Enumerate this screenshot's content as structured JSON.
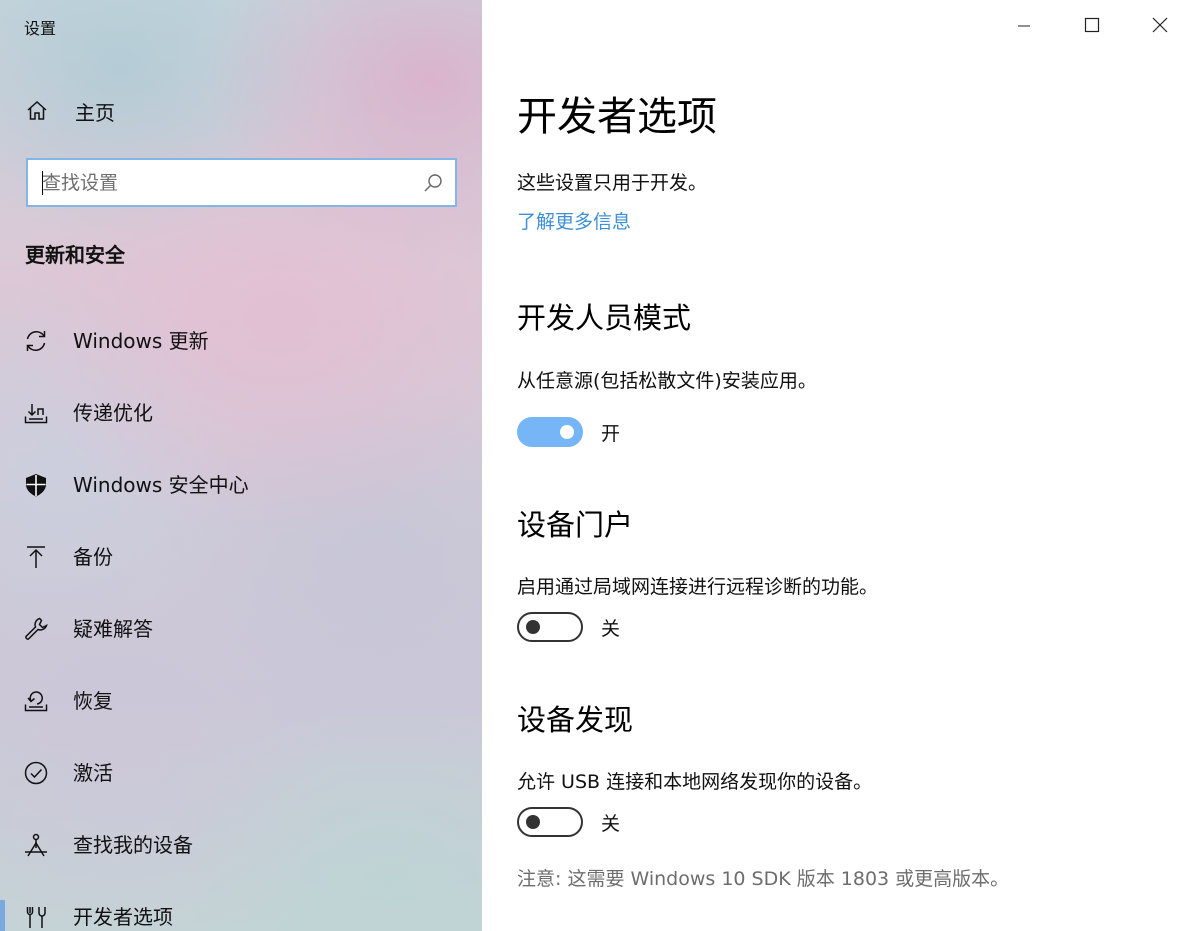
{
  "window": {
    "title": "设置"
  },
  "sidebar": {
    "home_label": "主页",
    "search_placeholder": "查找设置",
    "section_title": "更新和安全",
    "items": [
      {
        "label": "Windows 更新",
        "icon": "refresh-icon"
      },
      {
        "label": "传递优化",
        "icon": "delivery-optimization-icon"
      },
      {
        "label": "Windows 安全中心",
        "icon": "shield-icon"
      },
      {
        "label": "备份",
        "icon": "backup-arrow-icon"
      },
      {
        "label": "疑难解答",
        "icon": "wrench-icon"
      },
      {
        "label": "恢复",
        "icon": "recovery-icon"
      },
      {
        "label": "激活",
        "icon": "checkmark-circle-icon"
      },
      {
        "label": "查找我的设备",
        "icon": "find-device-icon"
      },
      {
        "label": "开发者选项",
        "icon": "developer-tools-icon",
        "selected": true
      }
    ]
  },
  "main": {
    "title": "开发者选项",
    "description": "这些设置只用于开发。",
    "learn_more": "了解更多信息",
    "sections": {
      "developer_mode": {
        "title": "开发人员模式",
        "description": "从任意源(包括松散文件)安装应用。",
        "toggle_label": "开",
        "state": "on"
      },
      "device_portal": {
        "title": "设备门户",
        "description": "启用通过局域网连接进行远程诊断的功能。",
        "toggle_label": "关",
        "state": "off"
      },
      "device_discovery": {
        "title": "设备发现",
        "description": "允许 USB 连接和本地网络发现你的设备。",
        "toggle_label": "关",
        "state": "off",
        "note": "注意: 这需要 Windows 10 SDK 版本 1803 或更高版本。"
      }
    }
  },
  "colors": {
    "accent": "#76b5f6",
    "link": "#3c8fd8",
    "search_border": "#82b6e6",
    "note_text": "#6d6d6d"
  }
}
